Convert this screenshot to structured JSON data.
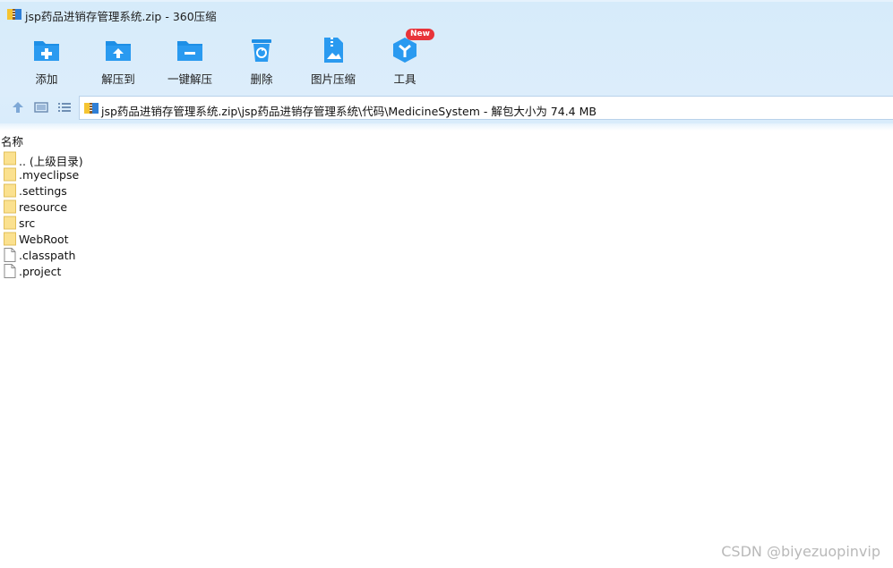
{
  "window": {
    "title": "jsp药品进销存管理系统.zip - 360压缩"
  },
  "toolbar": {
    "items": [
      {
        "label": "添加",
        "icon": "add-folder-icon"
      },
      {
        "label": "解压到",
        "icon": "extract-to-folder-icon"
      },
      {
        "label": "一键解压",
        "icon": "one-click-extract-icon"
      },
      {
        "label": "删除",
        "icon": "trash-icon"
      },
      {
        "label": "图片压缩",
        "icon": "image-compress-icon"
      },
      {
        "label": "工具",
        "icon": "tools-icon"
      }
    ],
    "new_badge": "New"
  },
  "nav": {
    "up": "up-arrow-icon",
    "thumbnail_view": "thumbnail-view-icon",
    "list_view": "list-view-icon"
  },
  "address": {
    "path": "jsp药品进销存管理系统.zip\\jsp药品进销存管理系统\\代码\\MedicineSystem - 解包大小为 74.4 MB"
  },
  "list": {
    "column_name": "名称",
    "rows": [
      {
        "name": ".. (上级目录)",
        "type": "folder"
      },
      {
        "name": ".myeclipse",
        "type": "folder"
      },
      {
        "name": ".settings",
        "type": "folder"
      },
      {
        "name": "resource",
        "type": "folder"
      },
      {
        "name": "src",
        "type": "folder"
      },
      {
        "name": "WebRoot",
        "type": "folder"
      },
      {
        "name": ".classpath",
        "type": "file"
      },
      {
        "name": ".project",
        "type": "file"
      }
    ]
  },
  "watermark": "CSDN @biyezuopinvip",
  "colors": {
    "accent": "#1e8fe6",
    "folder": "#fbe18f",
    "badge": "#e8343a"
  }
}
